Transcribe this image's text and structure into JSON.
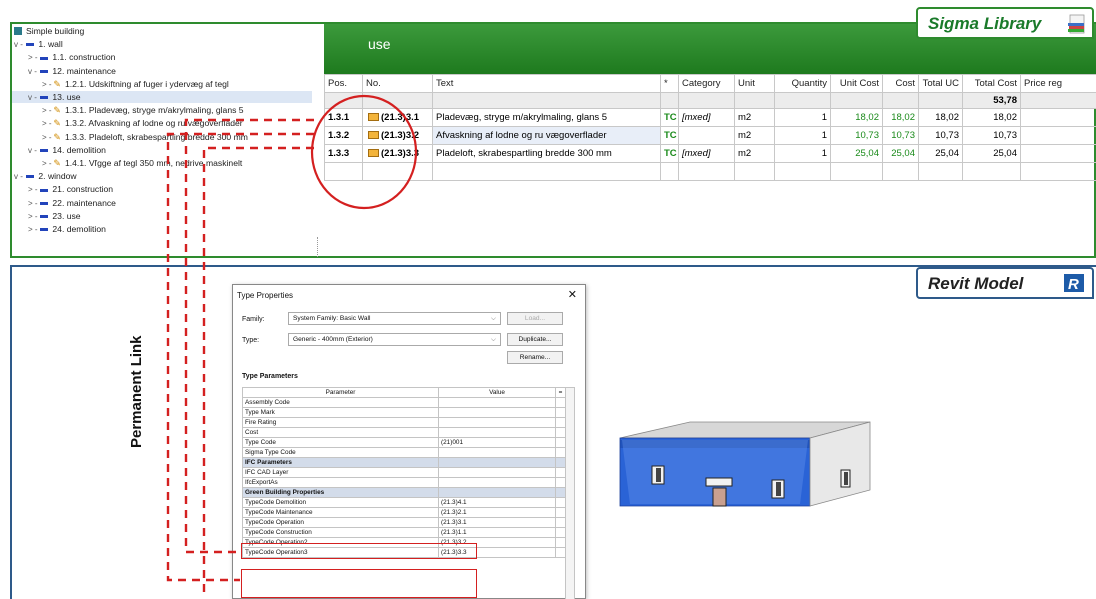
{
  "badges": {
    "sigma": "Sigma Library",
    "revit": "Revit Model"
  },
  "link_label": "Permanent  Link",
  "tree": [
    {
      "level": 0,
      "icon": "building-icon",
      "text": "Simple building"
    },
    {
      "level": 0,
      "icon": "bullet",
      "exp": "v -",
      "text": "1. wall"
    },
    {
      "level": 1,
      "icon": "bullet",
      "exp": "> -",
      "text": "1.1. construction"
    },
    {
      "level": 1,
      "icon": "bullet",
      "exp": "v -",
      "text": "12. maintenance"
    },
    {
      "level": 2,
      "icon": "pencil",
      "exp": "> -",
      "text": "1.2.1. Udskiftning af fuger i ydervæg af tegl"
    },
    {
      "level": 1,
      "icon": "bullet",
      "exp": "v -",
      "text": "13. use",
      "selected": true
    },
    {
      "level": 2,
      "icon": "pencil",
      "exp": "> -",
      "text": "1.3.1. Pladevæg, stryge m/akrylmaling, glans 5"
    },
    {
      "level": 2,
      "icon": "pencil",
      "exp": "> -",
      "text": "1.3.2. Afvaskning af lodne og ru vægoverflader"
    },
    {
      "level": 2,
      "icon": "pencil",
      "exp": "> -",
      "text": "1.3.3. Pladeloft, skrabespartling bredde 300 mm"
    },
    {
      "level": 1,
      "icon": "bullet",
      "exp": "v -",
      "text": "14. demolition"
    },
    {
      "level": 2,
      "icon": "pencil",
      "exp": "> -",
      "text": "1.4.1. Vľgge af tegl 350 mm, nedrive maskinelt"
    },
    {
      "level": 0,
      "icon": "bullet",
      "exp": "v -",
      "text": "2. window"
    },
    {
      "level": 1,
      "icon": "bullet",
      "exp": "> -",
      "text": "21. construction"
    },
    {
      "level": 1,
      "icon": "bullet",
      "exp": "> -",
      "text": "22. maintenance"
    },
    {
      "level": 1,
      "icon": "bullet",
      "exp": "> -",
      "text": "23. use"
    },
    {
      "level": 1,
      "icon": "bullet",
      "exp": "> -",
      "text": "24. demolition"
    }
  ],
  "grid": {
    "header_title": "use",
    "columns": [
      "Pos.",
      "No.",
      "Text",
      "*",
      "Category",
      "Unit",
      "Quantity",
      "Unit Cost",
      "Cost",
      "Total UC",
      "Total Cost",
      "Price reg"
    ],
    "summary_total": "53,78",
    "rows": [
      {
        "pos": "1.3.1",
        "no": "(21.3)3.1",
        "text": "Pladevæg, stryge m/akrylmaling, glans 5",
        "star": "TC",
        "category": "[mxed]",
        "unit": "m2",
        "qty": "1",
        "unit_cost": "18,02",
        "cost": "18,02",
        "total_uc": "18,02",
        "total_cost": "18,02"
      },
      {
        "pos": "1.3.2",
        "no": "(21.3)3.2",
        "text": "Afvaskning af lodne og ru vægoverflader",
        "star": "TC",
        "category": "",
        "unit": "m2",
        "qty": "1",
        "unit_cost": "10,73",
        "cost": "10,73",
        "total_uc": "10,73",
        "total_cost": "10,73"
      },
      {
        "pos": "1.3.3",
        "no": "(21.3)3.3",
        "text": "Pladeloft, skrabespartling bredde 300 mm",
        "star": "TC",
        "category": "[mxed]",
        "unit": "m2",
        "qty": "1",
        "unit_cost": "25,04",
        "cost": "25,04",
        "total_uc": "25,04",
        "total_cost": "25,04"
      }
    ]
  },
  "dialog": {
    "title": "Type Properties",
    "family_label": "Family:",
    "family_value": "System Family: Basic Wall",
    "type_label": "Type:",
    "type_value": "Generic - 400mm (Exterior)",
    "load_btn": "Load...",
    "duplicate_btn": "Duplicate...",
    "rename_btn": "Rename...",
    "section": "Type Parameters",
    "col_param": "Parameter",
    "col_value": "Value",
    "col_extra": "=",
    "rows": [
      {
        "p": "Assembly Code",
        "v": ""
      },
      {
        "p": "Type Mark",
        "v": ""
      },
      {
        "p": "Fire Rating",
        "v": ""
      },
      {
        "p": "Cost",
        "v": ""
      },
      {
        "p": "Type Code",
        "v": "(21)001"
      },
      {
        "p": "Sigma Type Code",
        "v": ""
      },
      {
        "p": "IFC Parameters",
        "v": "",
        "group": true
      },
      {
        "p": "IFC CAD Layer",
        "v": ""
      },
      {
        "p": "IfcExportAs",
        "v": ""
      },
      {
        "p": "Green Building Properties",
        "v": "",
        "group": true
      },
      {
        "p": "TypeCode Demolition",
        "v": "(21.3)4.1"
      },
      {
        "p": "TypeCode Maintenance",
        "v": "(21.3)2.1"
      },
      {
        "p": "TypeCode Operation",
        "v": "(21.3)3.1"
      },
      {
        "p": "TypeCode Construction",
        "v": "(21.3)1.1"
      },
      {
        "p": "TypeCode Operation2",
        "v": "(21.3)3.2"
      },
      {
        "p": "TypeCode Operation3",
        "v": "(21.3)3.3"
      }
    ]
  },
  "colors": {
    "green": "#2e8b2e",
    "red": "#d42020",
    "blue": "#2e5a8a"
  }
}
